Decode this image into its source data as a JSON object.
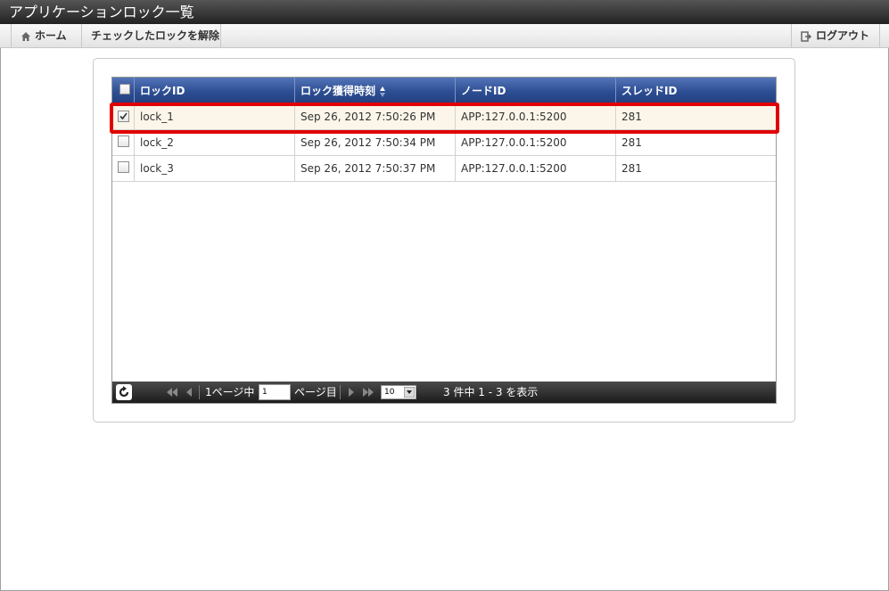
{
  "window": {
    "title": "アプリケーションロック一覧"
  },
  "toolbar": {
    "home_label": "ホーム",
    "release_label": "チェックしたロックを解除",
    "logout_label": "ログアウト"
  },
  "grid": {
    "columns": [
      "ロックID",
      "ロック獲得時刻",
      "ノードID",
      "スレッドID"
    ],
    "sort_column": "ロック獲得時刻",
    "rows": [
      {
        "checked": true,
        "lock_id": "lock_1",
        "time": "Sep 26, 2012 7:50:26 PM",
        "node": "APP:127.0.0.1:5200",
        "thread": "281"
      },
      {
        "checked": false,
        "lock_id": "lock_2",
        "time": "Sep 26, 2012 7:50:34 PM",
        "node": "APP:127.0.0.1:5200",
        "thread": "281"
      },
      {
        "checked": false,
        "lock_id": "lock_3",
        "time": "Sep 26, 2012 7:50:37 PM",
        "node": "APP:127.0.0.1:5200",
        "thread": "281"
      }
    ]
  },
  "pager": {
    "page_prefix": "1ページ中",
    "page_value": "1",
    "page_suffix": "ページ目",
    "page_size": "10",
    "summary": "3 件中 1 - 3 を表示"
  },
  "colors": {
    "header": "#2c4d92",
    "highlight": "#e10000",
    "selected_row": "#fbf6e9"
  }
}
